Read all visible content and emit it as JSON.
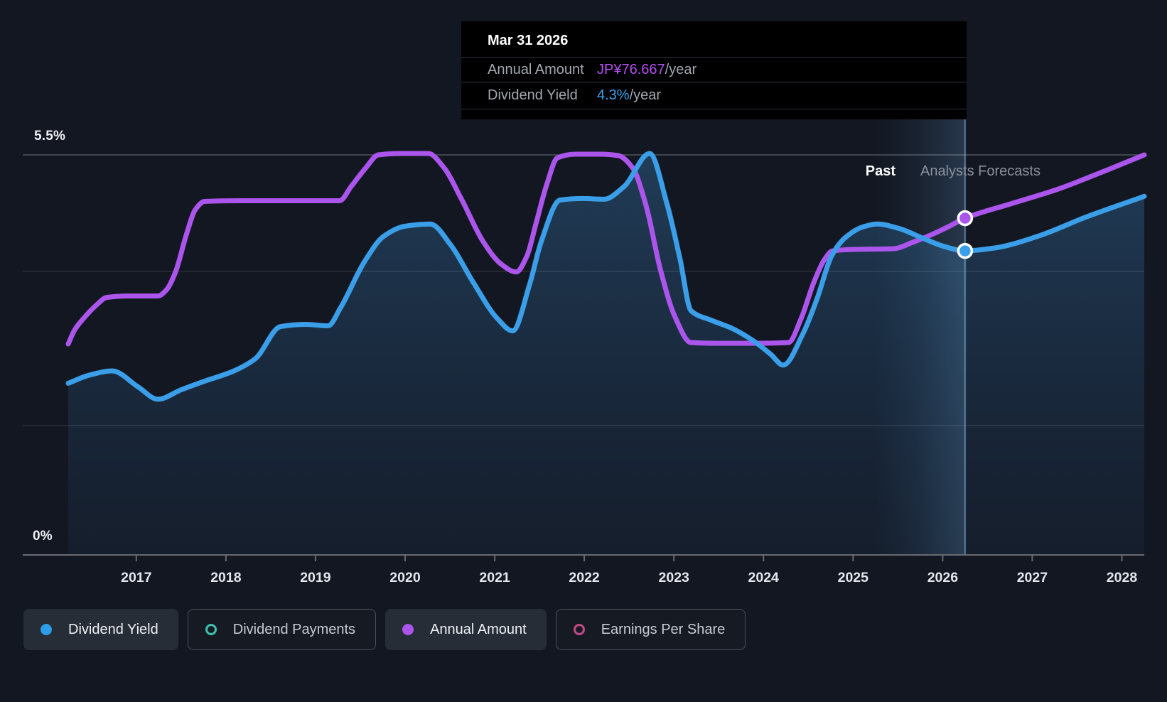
{
  "colors": {
    "background": "#131721",
    "yield_blue": "#3b9ee8",
    "annual_purple": "#ab55ec",
    "payments_teal": "#3fc1ad",
    "eps_pink": "#c34a86",
    "tooltip_value_purple": "#b44ff2",
    "tooltip_value_blue": "#3aa2f0"
  },
  "tooltip": {
    "date": "Mar 31 2026",
    "rows": [
      {
        "label": "Annual Amount",
        "value": "JP¥76.667",
        "suffix": "/year",
        "color": "#b44ff2"
      },
      {
        "label": "Dividend Yield",
        "value": "4.3%",
        "suffix": "/year",
        "color": "#3aa2f0"
      }
    ]
  },
  "annotations": {
    "past_label": "Past",
    "forecast_label": "Analysts Forecasts"
  },
  "y_axis": {
    "top_label": "5.5%",
    "bottom_label": "0%"
  },
  "legend": [
    {
      "label": "Dividend Yield",
      "color": "#2e9ce8",
      "marker": "filled",
      "selected": true
    },
    {
      "label": "Dividend Payments",
      "color": "#3fc1ad",
      "marker": "ring",
      "selected": false
    },
    {
      "label": "Annual Amount",
      "color": "#ab55ec",
      "marker": "filled",
      "selected": true
    },
    {
      "label": "Earnings Per Share",
      "color": "#c34a86",
      "marker": "ring",
      "selected": false
    }
  ],
  "chart_data": {
    "type": "line",
    "title": "Dividend yield and annual amount history with analyst forecasts",
    "x_range": [
      2016.24,
      2028.25
    ],
    "y_range": [
      0,
      5.5
    ],
    "y_unit": "percent",
    "x_ticks": [
      2017,
      2018,
      2019,
      2020,
      2021,
      2022,
      2023,
      2024,
      2025,
      2026,
      2027,
      2028
    ],
    "gridlines_pct": [
      5.5,
      3.9,
      1.78
    ],
    "grid": true,
    "legend_position": "bottom",
    "hover": {
      "band_start_year": 2025.25,
      "marker_year": 2026.25,
      "marker_annual_pct": 4.63,
      "marker_yield_pct": 4.18,
      "annual_amount_value": "JP¥76.667/year",
      "dividend_yield_value": "4.3%/year"
    },
    "series": [
      {
        "name": "Annual Amount",
        "color": "#ab55ec",
        "note": "plotted on overlay scale, values given as equivalent left-axis percent",
        "points": [
          [
            2016.24,
            2.9
          ],
          [
            2016.31,
            3.09
          ],
          [
            2016.41,
            3.25
          ],
          [
            2016.55,
            3.43
          ],
          [
            2016.67,
            3.54
          ],
          [
            2016.9,
            3.56
          ],
          [
            2017.24,
            3.56
          ],
          [
            2017.34,
            3.65
          ],
          [
            2017.44,
            3.9
          ],
          [
            2017.56,
            4.41
          ],
          [
            2017.66,
            4.75
          ],
          [
            2017.76,
            4.86
          ],
          [
            2018.17,
            4.87
          ],
          [
            2018.81,
            4.87
          ],
          [
            2019.27,
            4.87
          ],
          [
            2019.4,
            5.07
          ],
          [
            2019.56,
            5.32
          ],
          [
            2019.7,
            5.5
          ],
          [
            2019.96,
            5.52
          ],
          [
            2020.26,
            5.52
          ],
          [
            2020.43,
            5.33
          ],
          [
            2020.63,
            4.89
          ],
          [
            2020.87,
            4.31
          ],
          [
            2021.07,
            4.0
          ],
          [
            2021.24,
            3.89
          ],
          [
            2021.36,
            4.11
          ],
          [
            2021.46,
            4.55
          ],
          [
            2021.58,
            5.09
          ],
          [
            2021.7,
            5.46
          ],
          [
            2021.9,
            5.51
          ],
          [
            2022.18,
            5.51
          ],
          [
            2022.38,
            5.49
          ],
          [
            2022.54,
            5.32
          ],
          [
            2022.69,
            4.8
          ],
          [
            2022.85,
            3.92
          ],
          [
            2023.01,
            3.28
          ],
          [
            2023.19,
            2.92
          ],
          [
            2023.49,
            2.91
          ],
          [
            2023.88,
            2.91
          ],
          [
            2024.28,
            2.92
          ],
          [
            2024.42,
            3.25
          ],
          [
            2024.56,
            3.74
          ],
          [
            2024.68,
            4.06
          ],
          [
            2024.77,
            4.18
          ],
          [
            2024.99,
            4.2
          ],
          [
            2025.45,
            4.21
          ],
          [
            2025.67,
            4.3
          ],
          [
            2025.87,
            4.4
          ],
          [
            2026.06,
            4.51
          ],
          [
            2026.25,
            4.63
          ],
          [
            2026.74,
            4.82
          ],
          [
            2027.29,
            5.03
          ],
          [
            2027.77,
            5.26
          ],
          [
            2028.25,
            5.5
          ]
        ]
      },
      {
        "name": "Dividend Yield",
        "color": "#3b9ee8",
        "fill": true,
        "points": [
          [
            2016.24,
            2.36
          ],
          [
            2016.47,
            2.47
          ],
          [
            2016.73,
            2.53
          ],
          [
            2017.02,
            2.31
          ],
          [
            2017.24,
            2.14
          ],
          [
            2017.5,
            2.27
          ],
          [
            2017.74,
            2.38
          ],
          [
            2018.09,
            2.53
          ],
          [
            2018.33,
            2.7
          ],
          [
            2018.61,
            3.14
          ],
          [
            2018.89,
            3.17
          ],
          [
            2019.14,
            3.15
          ],
          [
            2019.28,
            3.4
          ],
          [
            2019.55,
            4.04
          ],
          [
            2019.76,
            4.38
          ],
          [
            2020.0,
            4.52
          ],
          [
            2020.28,
            4.55
          ],
          [
            2020.51,
            4.26
          ],
          [
            2020.75,
            3.77
          ],
          [
            2021.03,
            3.25
          ],
          [
            2021.2,
            3.08
          ],
          [
            2021.39,
            3.72
          ],
          [
            2021.52,
            4.31
          ],
          [
            2021.73,
            4.88
          ],
          [
            2021.98,
            4.9
          ],
          [
            2022.22,
            4.89
          ],
          [
            2022.44,
            5.06
          ],
          [
            2022.73,
            5.52
          ],
          [
            2022.92,
            4.84
          ],
          [
            2023.07,
            4.06
          ],
          [
            2023.19,
            3.36
          ],
          [
            2023.41,
            3.23
          ],
          [
            2023.64,
            3.12
          ],
          [
            2023.88,
            2.95
          ],
          [
            2024.08,
            2.76
          ],
          [
            2024.22,
            2.61
          ],
          [
            2024.44,
            3.04
          ],
          [
            2024.6,
            3.53
          ],
          [
            2024.76,
            4.11
          ],
          [
            2024.91,
            4.36
          ],
          [
            2025.11,
            4.51
          ],
          [
            2025.27,
            4.55
          ],
          [
            2025.51,
            4.49
          ],
          [
            2025.75,
            4.37
          ],
          [
            2026.02,
            4.24
          ],
          [
            2026.25,
            4.18
          ],
          [
            2026.58,
            4.22
          ],
          [
            2027.06,
            4.38
          ],
          [
            2027.61,
            4.65
          ],
          [
            2028.25,
            4.93
          ]
        ]
      }
    ]
  }
}
